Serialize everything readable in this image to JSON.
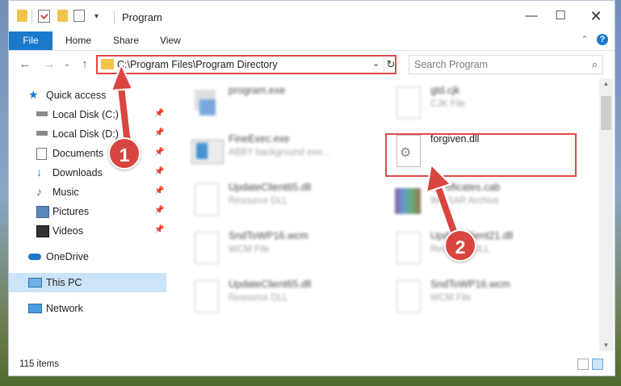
{
  "window": {
    "title": "Program"
  },
  "ribbon": {
    "tabs": [
      "File",
      "Home",
      "Share",
      "View"
    ],
    "help_icon": "?",
    "collapse_icon": "^"
  },
  "nav": {
    "back": "←",
    "forward": "→",
    "up": "↑",
    "recent": "⌄"
  },
  "address": {
    "path": "C:\\Program Files\\Program Directory"
  },
  "search": {
    "placeholder": "Search Program"
  },
  "sidebar": {
    "items": [
      {
        "label": "Quick access",
        "icon": "star-icon",
        "pinned": false
      },
      {
        "label": "Local Disk (C:)",
        "icon": "drive-icon",
        "pinned": true
      },
      {
        "label": "Local Disk (D:)",
        "icon": "drive-icon",
        "pinned": true
      },
      {
        "label": "Documents",
        "icon": "documents-icon",
        "pinned": true
      },
      {
        "label": "Downloads",
        "icon": "download-icon",
        "pinned": true
      },
      {
        "label": "Music",
        "icon": "music-icon",
        "pinned": true
      },
      {
        "label": "Pictures",
        "icon": "pictures-icon",
        "pinned": true
      },
      {
        "label": "Videos",
        "icon": "videos-icon",
        "pinned": true
      },
      {
        "label": "OneDrive",
        "icon": "cloud-icon",
        "pinned": false
      },
      {
        "label": "This PC",
        "icon": "pc-icon",
        "pinned": false
      },
      {
        "label": "Network",
        "icon": "network-icon",
        "pinned": false
      }
    ]
  },
  "files": [
    {
      "name": "program.exe",
      "type": ""
    },
    {
      "name": "gtd.cjk",
      "type": "CJK File"
    },
    {
      "name": "FineExec.exe",
      "type": "ABBY background exe..."
    },
    {
      "name": "forgiven.dll",
      "type": ""
    },
    {
      "name": "UpdateClient65.dll",
      "type": "Resource DLL"
    },
    {
      "name": "Certificates.cab",
      "type": "WinRAR Archive"
    },
    {
      "name": "SndToWP16.wcm",
      "type": "WCM File"
    },
    {
      "name": "UpdateClient21.dll",
      "type": "Resource DLL"
    },
    {
      "name": "UpdateClient65.dll",
      "type": "Resource DLL"
    },
    {
      "name": "SndToWP16.wcm",
      "type": "WCM File"
    }
  ],
  "status": {
    "items": "115 items"
  },
  "callouts": {
    "one": "1",
    "two": "2"
  },
  "colors": {
    "accent": "#1979ca",
    "highlight": "#e04848",
    "selected": "#cce4f7"
  }
}
